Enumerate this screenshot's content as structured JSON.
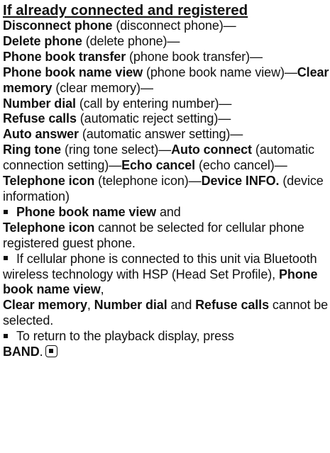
{
  "heading": "If already connected and registered",
  "menu_sequence": [
    {
      "term": "Disconnect phone",
      "desc": " (disconnect phone)—"
    },
    {
      "term": "Delete phone",
      "desc": " (delete phone)—"
    },
    {
      "term": "Phone book transfer",
      "desc": " (phone book transfer)—"
    },
    {
      "term": "Phone book name view",
      "desc": " (phone book name view)—"
    },
    {
      "term": "Clear memory",
      "desc": " (clear memory)—"
    },
    {
      "term": "Number dial",
      "desc": " (call by entering number)—"
    },
    {
      "term": "Refuse calls",
      "desc": " (automatic reject setting)—"
    },
    {
      "term": "Auto answer",
      "desc": " (automatic answer setting)—"
    },
    {
      "term": "Ring tone",
      "desc": " (ring tone select)—"
    },
    {
      "term": "Auto connect",
      "desc": " (automatic connection setting)—"
    },
    {
      "term": "Echo cancel",
      "desc": " (echo cancel)—"
    },
    {
      "term": "Telephone icon",
      "desc": " (telephone icon)—"
    },
    {
      "term": "Device INFO.",
      "desc": " (device information)"
    }
  ],
  "note1": {
    "term_a": "Phone book name view",
    "joiner": " and",
    "term_b": "Telephone icon",
    "text": " cannot be selected for cellular phone registered guest phone."
  },
  "note2": {
    "text": "If cellular phone is connected to this unit via Bluetooth wireless technology with HSP (Head Set Profile), ",
    "term_a": "Phone book name view",
    "sep_a": ",",
    "term_b": "Clear memory",
    "sep_b": ", ",
    "term_c": "Number dial",
    "sep_c": " and ",
    "term_d": "Refuse calls",
    "tail": " cannot be selected."
  },
  "note3": {
    "text": "To return to the playback display, press",
    "term": "BAND",
    "period": "."
  },
  "icons": {
    "bullet": "square-bullet",
    "end_mark": "stop-square-icon"
  }
}
